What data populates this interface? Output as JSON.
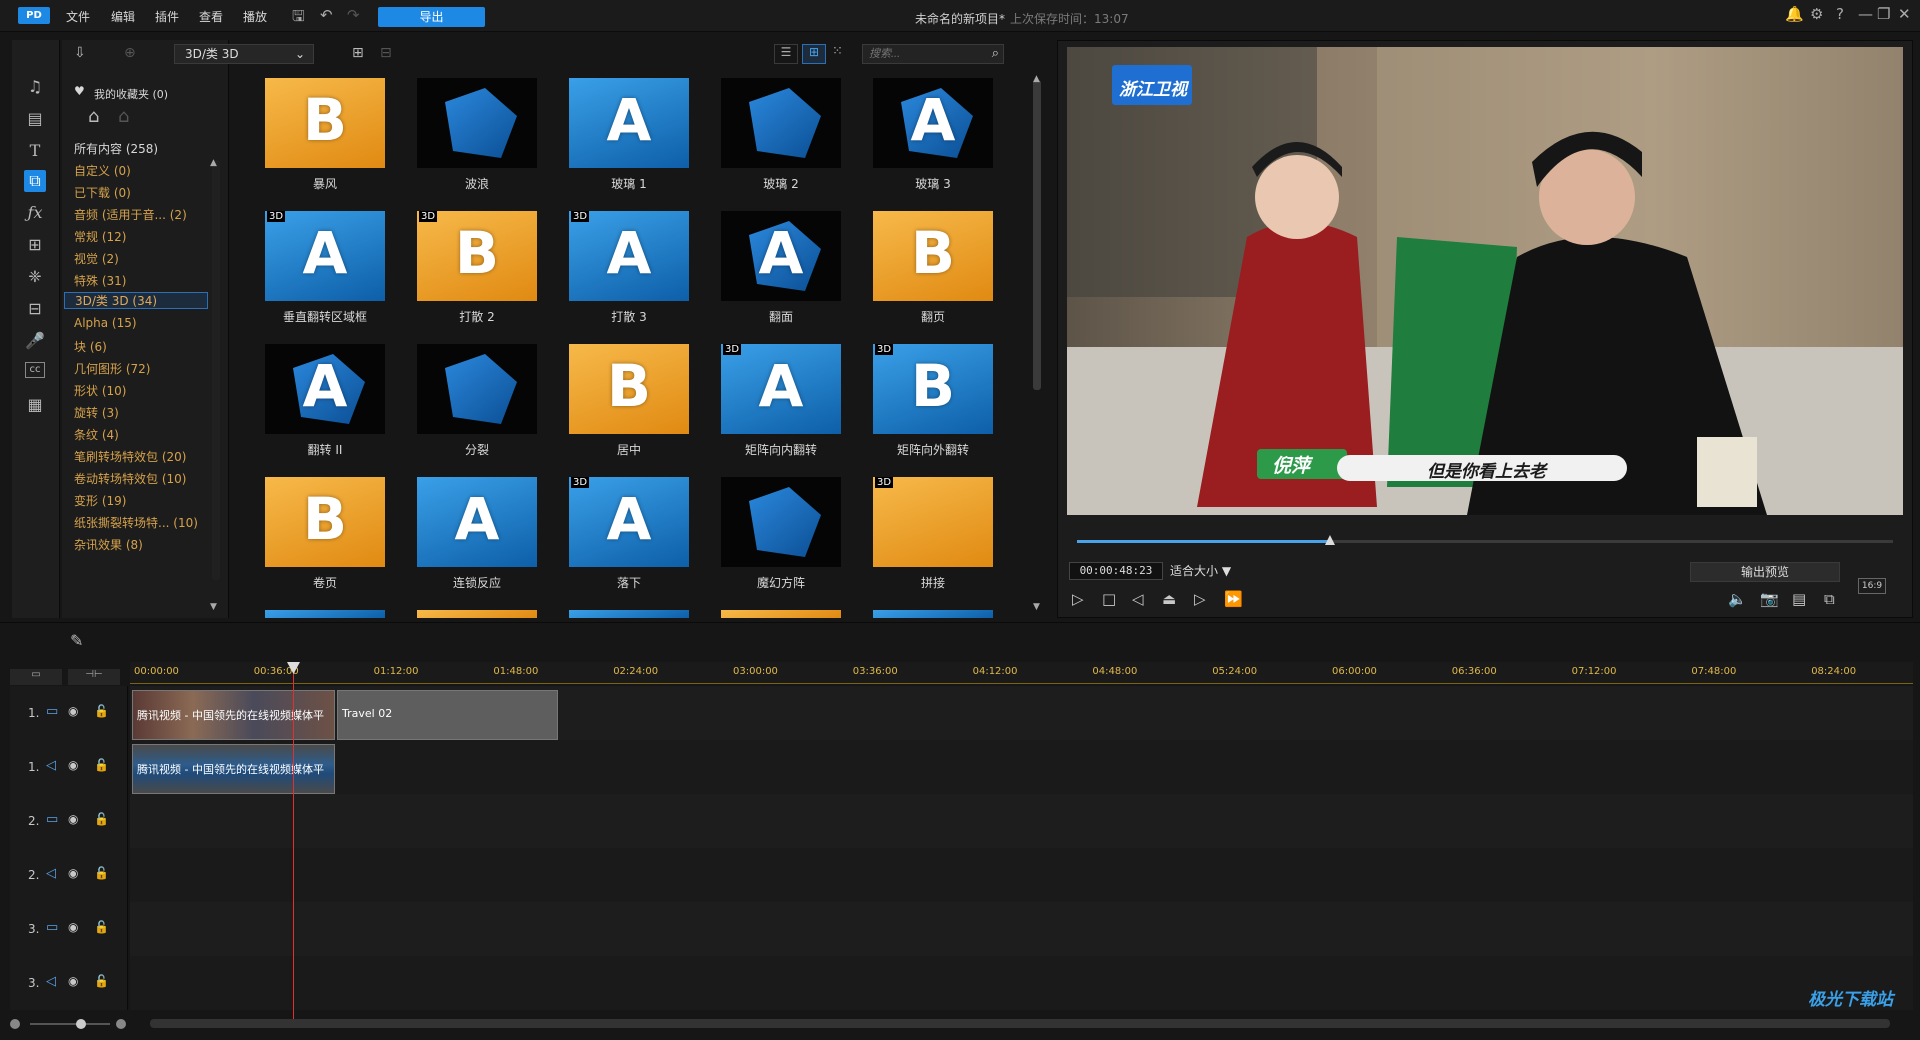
{
  "titlebar": {
    "logo": "PD",
    "menus": [
      "文件",
      "编辑",
      "插件",
      "查看",
      "播放"
    ],
    "export_label": "导出",
    "project_title": "未命名的新项目*",
    "save_status": "上次保存时间：13:07",
    "win_buttons": [
      "?",
      "—",
      "❐",
      "✕"
    ]
  },
  "library": {
    "dropdown_value": "3D/类 3D",
    "search_placeholder": "搜索..."
  },
  "categories": {
    "favorites": "我的收藏夹 (0)",
    "all": "所有内容 (258)",
    "items": [
      "自定义 (0)",
      "已下载 (0)",
      "音频 (适用于音... (2)",
      "常规 (12)",
      "视觉 (2)",
      "特殊 (31)",
      "3D/类 3D (34)",
      "Alpha (15)",
      "块 (6)",
      "几何图形 (72)",
      "形状 (10)",
      "旋转 (3)",
      "条纹 (4)",
      "笔刷转场特效包 (20)",
      "卷动转场特效包 (10)",
      "变形 (19)",
      "纸张撕裂转场特... (10)",
      "杂讯效果 (8)"
    ]
  },
  "effects": [
    {
      "label": "暴风",
      "style": "orange",
      "letter": "B",
      "badge": ""
    },
    {
      "label": "波浪",
      "style": "black",
      "letter": "",
      "badge": ""
    },
    {
      "label": "玻璃 1",
      "style": "blue",
      "letter": "A",
      "badge": ""
    },
    {
      "label": "玻璃 2",
      "style": "black",
      "letter": "",
      "badge": ""
    },
    {
      "label": "玻璃 3",
      "style": "black",
      "letter": "A",
      "badge": ""
    },
    {
      "label": "垂直翻转区域框",
      "style": "blue",
      "letter": "A",
      "badge": "3D"
    },
    {
      "label": "打散 2",
      "style": "orange",
      "letter": "B",
      "badge": "3D"
    },
    {
      "label": "打散 3",
      "style": "blue",
      "letter": "A",
      "badge": "3D"
    },
    {
      "label": "翻面",
      "style": "black",
      "letter": "A",
      "badge": ""
    },
    {
      "label": "翻页",
      "style": "orange",
      "letter": "B",
      "badge": ""
    },
    {
      "label": "翻转 II",
      "style": "black",
      "letter": "A",
      "badge": ""
    },
    {
      "label": "分裂",
      "style": "black",
      "letter": "",
      "badge": ""
    },
    {
      "label": "居中",
      "style": "orange",
      "letter": "B",
      "badge": ""
    },
    {
      "label": "矩阵向内翻转",
      "style": "blue",
      "letter": "A",
      "badge": "3D"
    },
    {
      "label": "矩阵向外翻转",
      "style": "blue",
      "letter": "B",
      "badge": "3D"
    },
    {
      "label": "卷页",
      "style": "orange",
      "letter": "B",
      "badge": ""
    },
    {
      "label": "连锁反应",
      "style": "blue",
      "letter": "A",
      "badge": ""
    },
    {
      "label": "落下",
      "style": "blue",
      "letter": "A",
      "badge": "3D"
    },
    {
      "label": "魔幻方阵",
      "style": "black",
      "letter": "",
      "badge": ""
    },
    {
      "label": "拼接",
      "style": "orange",
      "letter": "",
      "badge": "3D"
    }
  ],
  "preview": {
    "channel_logo": "浙江卫视",
    "name_caption": "倪萍",
    "subtitle": "但是你看上去老",
    "timecode": "00:00:48:23",
    "fit_label": "适合大小 ▼",
    "output_preview": "输出预览",
    "aspect": "16:9",
    "progress": 0.31
  },
  "timeline": {
    "ticks": [
      "00:00:00",
      "00:36:00",
      "01:12:00",
      "01:48:00",
      "02:24:00",
      "03:00:00",
      "03:36:00",
      "04:12:00",
      "04:48:00",
      "05:24:00",
      "06:00:00",
      "06:36:00",
      "07:12:00",
      "07:48:00",
      "08:24:00"
    ],
    "tracks": [
      {
        "name": "1.",
        "type": "video"
      },
      {
        "name": "1.",
        "type": "audio"
      },
      {
        "name": "2.",
        "type": "video"
      },
      {
        "name": "2.",
        "type": "audio"
      },
      {
        "name": "3.",
        "type": "video"
      },
      {
        "name": "3.",
        "type": "audio"
      }
    ],
    "clip_video": "腾讯视频 - 中国领先的在线视频媒体平",
    "clip_audio": "腾讯视频 - 中国领先的在线视频媒体平",
    "clip_travel": "Travel 02"
  },
  "watermark": "极光下载站",
  "colors": {
    "accent": "#1e88e5",
    "category": "#d5a24c",
    "playhead": "#e23030"
  }
}
